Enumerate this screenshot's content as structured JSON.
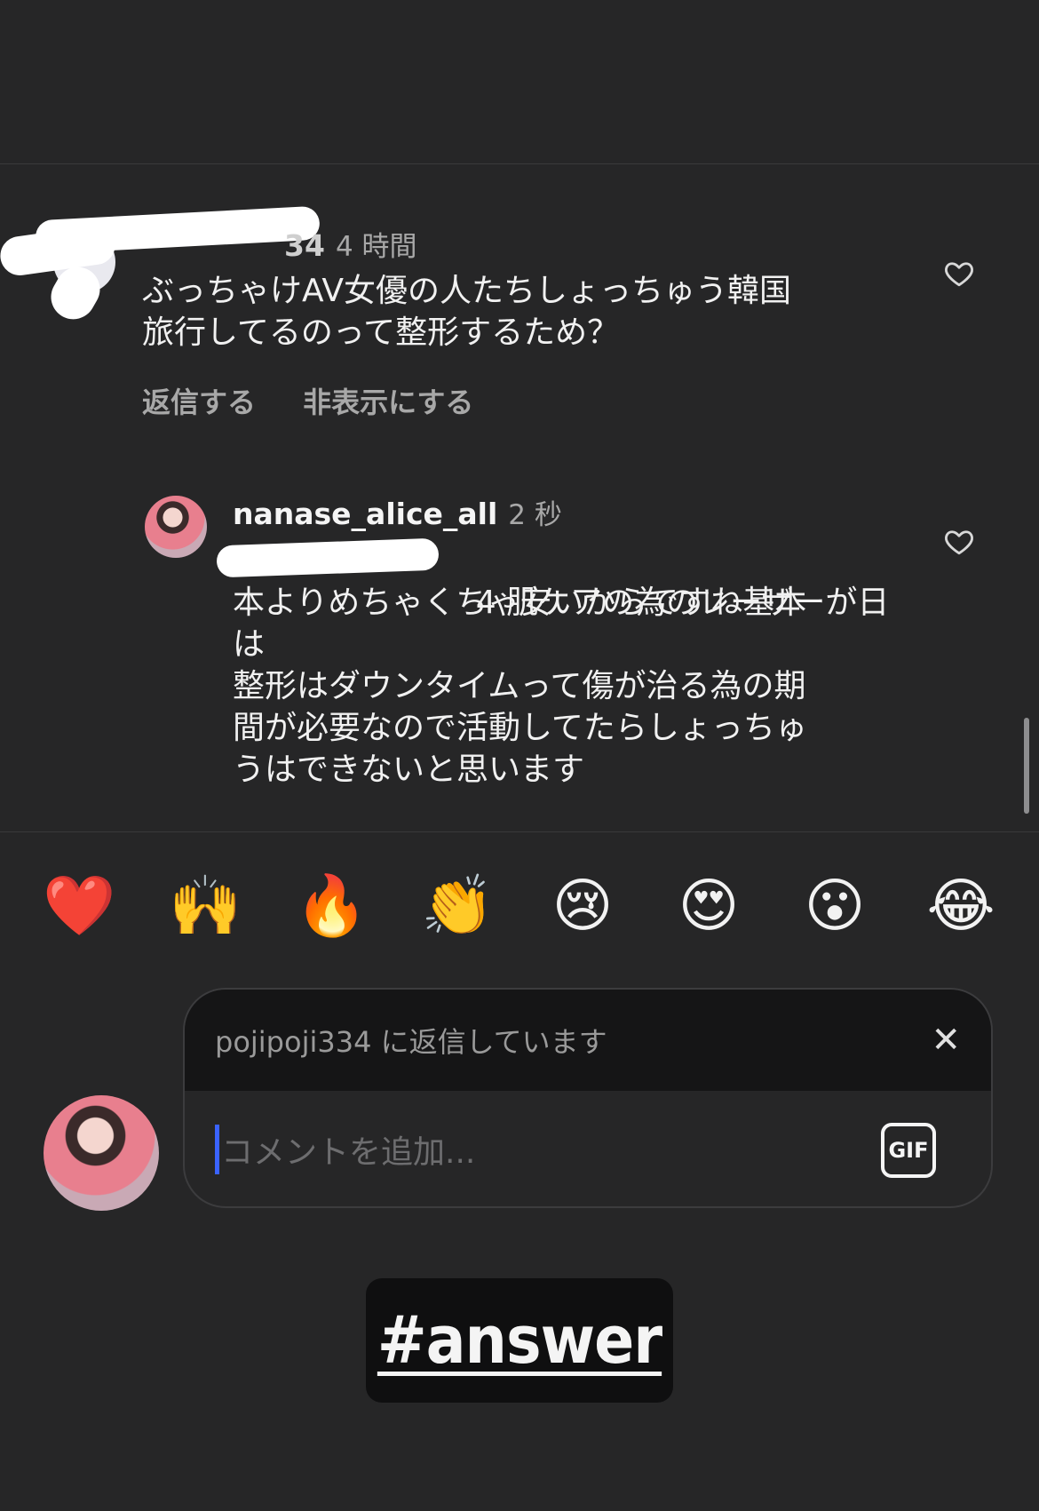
{
  "comment1": {
    "username_visible": "34",
    "time": "4 時間",
    "text": "ぶっちゃけAV女優の人たちしょっちゅう韓国\n旅行してるのって整形するため？",
    "actions": [
      "返信する",
      "非表示にする"
    ],
    "like_icon": "heart-outline-icon"
  },
  "reply1": {
    "username": "nanase_alice_all",
    "time": "2 秒",
    "mention_suffix": "4",
    "text_line1": " 肌ケアの為のレーザーが日",
    "text_rest": "本よりめちゃくちゃ安いからですね基本\nは\n整形はダウンタイムって傷が治る為の期\n間が必要なので活動してたらしょっちゅ\nうはできないと思います",
    "like_icon": "heart-outline-icon"
  },
  "reactions": [
    {
      "name": "red-heart",
      "glyph": "❤️"
    },
    {
      "name": "raising-hands",
      "glyph": "🙌"
    },
    {
      "name": "fire",
      "glyph": "🔥"
    },
    {
      "name": "clapping-hands",
      "glyph": "👏"
    },
    {
      "name": "crying-face",
      "glyph": "😢"
    },
    {
      "name": "heart-eyes",
      "glyph": "😍"
    },
    {
      "name": "surprised-face",
      "glyph": "😮"
    },
    {
      "name": "tears-of-joy",
      "glyph": "😂"
    }
  ],
  "composer": {
    "replying_to": "pojipoji334 に返信しています",
    "close_glyph": "✕",
    "placeholder": "コメントを追加...",
    "gif_label": "GIF"
  },
  "sticker": {
    "hashtag": "#answer"
  }
}
